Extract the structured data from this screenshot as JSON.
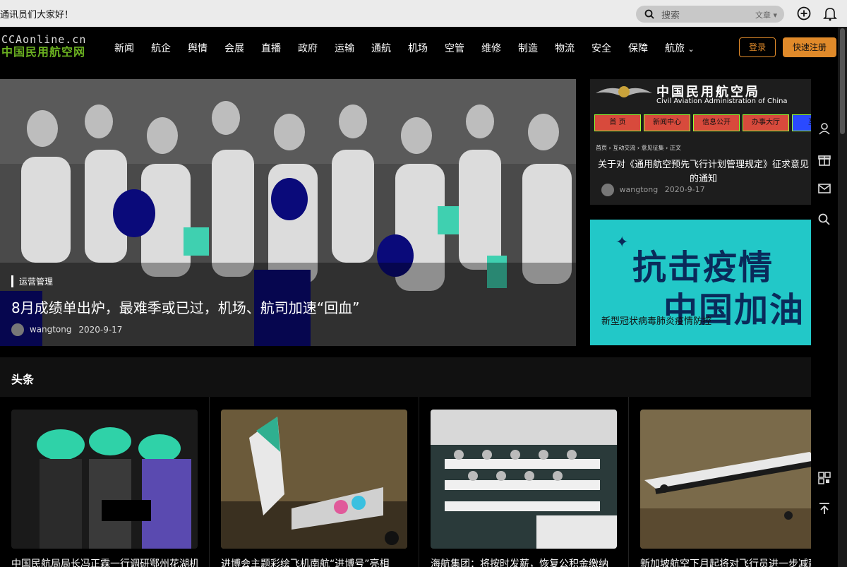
{
  "topbar": {
    "greeting": "通讯员们大家好！",
    "search_placeholder": "搜索",
    "search_scope": "文章",
    "icons": [
      "search-icon",
      "add-circle-icon",
      "bell-icon"
    ]
  },
  "logo": {
    "line1": "CCAonline.cn",
    "line2": "中国民用航空网"
  },
  "nav": {
    "items": [
      "新闻",
      "航企",
      "舆情",
      "会展",
      "直播",
      "政府",
      "运输",
      "通航",
      "机场",
      "空管",
      "维修",
      "制造",
      "物流",
      "安全",
      "保障",
      "航旅"
    ],
    "login": "登录",
    "register": "快速注册"
  },
  "hero": {
    "category": "运营管理",
    "title": "8月成绩单出炉，最难季或已过，机场、航司加速“回血”",
    "author": "wangtong",
    "date": "2020-9-17"
  },
  "side_cards": {
    "card1": {
      "agency": "中国民用航空局",
      "agency_en": "Civil Aviation Administration of China",
      "tabs": [
        "首 页",
        "新闻中心",
        "信息公开",
        "办事大厅",
        "互动"
      ],
      "breadcrumb": "首页 › 互动交流 › 意见征集 › 正文",
      "title": "关于对《通用航空预先飞行计划管理规定》征求意见的通知",
      "author": "wangtong",
      "date": "2020-9-17"
    },
    "card2": {
      "banner_line1": "抗击疫情",
      "banner_line2": "中国加油",
      "caption": "新型冠状病毒肺炎疫情防控"
    }
  },
  "section": {
    "title": "头条",
    "articles": [
      "中国民航局局长冯正霖一行调研鄂州花湖机场建设",
      "进博会主题彩绘飞机南航“进博号”亮相",
      "海航集团：将按时发薪，恢复公积金缴纳",
      "新加坡航空下月起将对飞行员进一步减薪"
    ]
  },
  "sidebar_icons": [
    "user-icon",
    "gift-icon",
    "mail-icon",
    "search-icon",
    "qrcode-icon",
    "back-to-top-icon"
  ]
}
